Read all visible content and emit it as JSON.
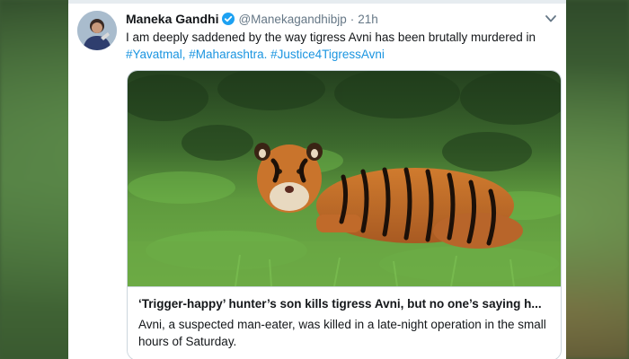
{
  "tweet": {
    "author_name": "Maneka Gandhi",
    "handle": "@Manekagandhibjp",
    "separator": "·",
    "time": "21h",
    "text_plain": "I am deeply saddened by the way tigress Avni has been brutally murdered in",
    "hashtag_1": "#Yavatmal,",
    "hashtag_2": "#Maharashtra.",
    "hashtag_3": "#Justice4TigressAvni"
  },
  "link_card": {
    "title": "‘Trigger-happy’ hunter’s son kills tigress Avni, but no one’s saying h...",
    "description": "Avni, a suspected man-eater, was killed in a late-night operation in the small hours of Saturday."
  },
  "icons": {
    "verified": "verified-badge-icon",
    "menu": "chevron-down-icon"
  },
  "colors": {
    "hashtag": "#1b95e0",
    "verified": "#1da1f2",
    "muted": "#657786"
  }
}
